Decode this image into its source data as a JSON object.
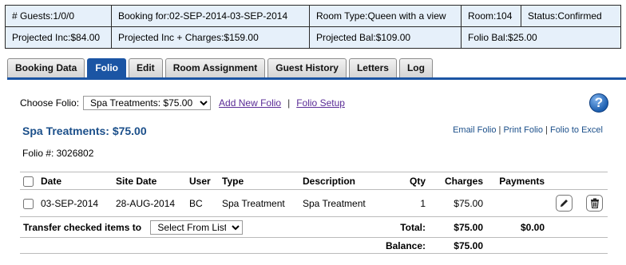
{
  "info": {
    "guests": "# Guests:1/0/0",
    "booking": "Booking for:02-SEP-2014-03-SEP-2014",
    "room_type": "Room Type:Queen with a view",
    "room": "Room:104",
    "status": "Status:Confirmed",
    "projected_inc": "Projected Inc:$84.00",
    "projected_inc_charges": "Projected Inc + Charges:$159.00",
    "projected_bal": "Projected Bal:$109.00",
    "folio_bal": "Folio Bal:$25.00"
  },
  "tabs": [
    "Booking Data",
    "Folio",
    "Edit",
    "Room Assignment",
    "Guest History",
    "Letters",
    "Log"
  ],
  "active_tab": "Folio",
  "choose": {
    "label": "Choose Folio:",
    "selected": "Spa Treatments: $75.00",
    "add_link": "Add New Folio",
    "sep": "|",
    "setup_link": "Folio Setup"
  },
  "folio": {
    "title": "Spa Treatments: $75.00",
    "number": "Folio #: 3026802",
    "email": "Email Folio",
    "print": "Print Folio",
    "excel": "Folio to Excel",
    "sep": "|"
  },
  "columns": {
    "date": "Date",
    "site_date": "Site Date",
    "user": "User",
    "type": "Type",
    "description": "Description",
    "qty": "Qty",
    "charges": "Charges",
    "payments": "Payments"
  },
  "rows": [
    {
      "date": "03-SEP-2014",
      "site_date": "28-AUG-2014",
      "user": "BC",
      "type": "Spa Treatment",
      "description": "Spa Treatment",
      "qty": "1",
      "charges": "$75.00",
      "payments": ""
    }
  ],
  "transfer": {
    "label": "Transfer checked items to",
    "selected": "Select From List"
  },
  "totals": {
    "total_label": "Total:",
    "total_charges": "$75.00",
    "total_payments": "$0.00",
    "balance_label": "Balance:",
    "balance": "$75.00"
  },
  "icons": {
    "help": "help-icon",
    "edit": "pencil-icon",
    "delete": "trash-icon"
  },
  "colors": {
    "accent": "#1b55a4",
    "info_bg": "#e6f0fa",
    "title": "#1b4f8a"
  }
}
